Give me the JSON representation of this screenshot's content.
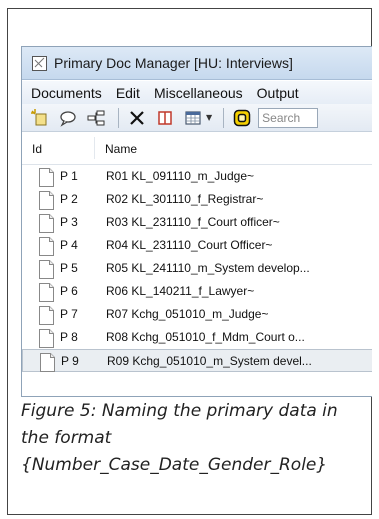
{
  "window": {
    "title": "Primary Doc Manager [HU: Interviews]"
  },
  "menubar": {
    "items": [
      "Documents",
      "Edit",
      "Miscellaneous",
      "Output"
    ]
  },
  "toolbar": {
    "buttons": [
      "new-document-icon",
      "comment-icon",
      "network-icon",
      "delete-icon",
      "split-pane-icon",
      "grid-view-icon",
      "highlight-icon"
    ],
    "search_placeholder": "Search"
  },
  "list": {
    "columns": {
      "id": "Id",
      "name": "Name"
    },
    "rows": [
      {
        "id": "P 1",
        "name": "R01 KL_091110_m_Judge~"
      },
      {
        "id": "P 2",
        "name": "R02 KL_301110_f_Registrar~"
      },
      {
        "id": "P 3",
        "name": "R03 KL_231110_f_Court officer~"
      },
      {
        "id": "P 4",
        "name": "R04 KL_231110_Court Officer~"
      },
      {
        "id": "P 5",
        "name": "R05 KL_241110_m_System develop..."
      },
      {
        "id": "P 6",
        "name": "R06 KL_140211_f_Lawyer~"
      },
      {
        "id": "P 7",
        "name": "R07 Kchg_051010_m_Judge~"
      },
      {
        "id": "P 8",
        "name": "R08 Kchg_051010_f_Mdm_Court o..."
      },
      {
        "id": "P 9",
        "name": "R09 Kchg_051010_m_System devel..."
      }
    ],
    "selected_index": 8
  },
  "caption": "Figure 5:  Naming the primary data in the format {Number_Case_Date_Gender_Role}",
  "colors": {
    "titlebar": "#c6d9ee",
    "selection": "#eaeef2",
    "highlight_icon": "#f5d000"
  }
}
